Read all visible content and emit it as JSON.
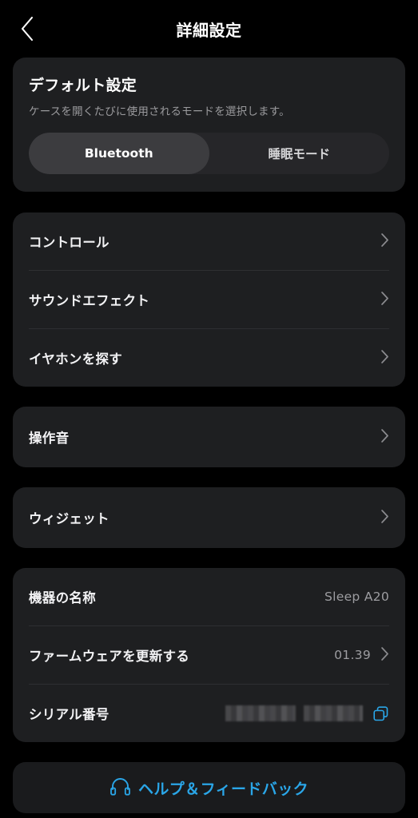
{
  "header": {
    "title": "詳細設定",
    "back_icon": "chevron-left-icon"
  },
  "default_settings": {
    "title": "デフォルト設定",
    "subtitle": "ケースを開くたびに使用されるモードを選択します。",
    "segments": [
      {
        "label": "Bluetooth",
        "selected": true
      },
      {
        "label": "睡眠モード",
        "selected": false
      }
    ]
  },
  "menu_group": {
    "items": [
      {
        "label": "コントロール",
        "icon": "chevron-right-icon"
      },
      {
        "label": "サウンドエフェクト",
        "icon": "chevron-right-icon"
      },
      {
        "label": "イヤホンを探す",
        "icon": "chevron-right-icon"
      }
    ]
  },
  "sound_card": {
    "label": "操作音",
    "icon": "chevron-right-icon"
  },
  "widget_card": {
    "label": "ウィジェット",
    "icon": "chevron-right-icon"
  },
  "device_info": {
    "rows": [
      {
        "label": "機器の名称",
        "value": "Sleep A20"
      },
      {
        "label": "ファームウェアを更新する",
        "value": "01.39",
        "icon": "chevron-right-icon"
      },
      {
        "label": "シリアル番号",
        "value": "",
        "icon": "copy-icon"
      }
    ]
  },
  "help": {
    "label": "ヘルプ＆フィードバック",
    "icon": "headphones-icon"
  },
  "colors": {
    "page_background": "#000000",
    "card_background": "#1e1f21",
    "segment_track": "#262629",
    "segment_selected": "#3c3c3f",
    "primary_text": "#ffffff",
    "secondary_text": "#9a9a9d",
    "accent": "#2aa6e8",
    "divider": "#2e2f32"
  }
}
